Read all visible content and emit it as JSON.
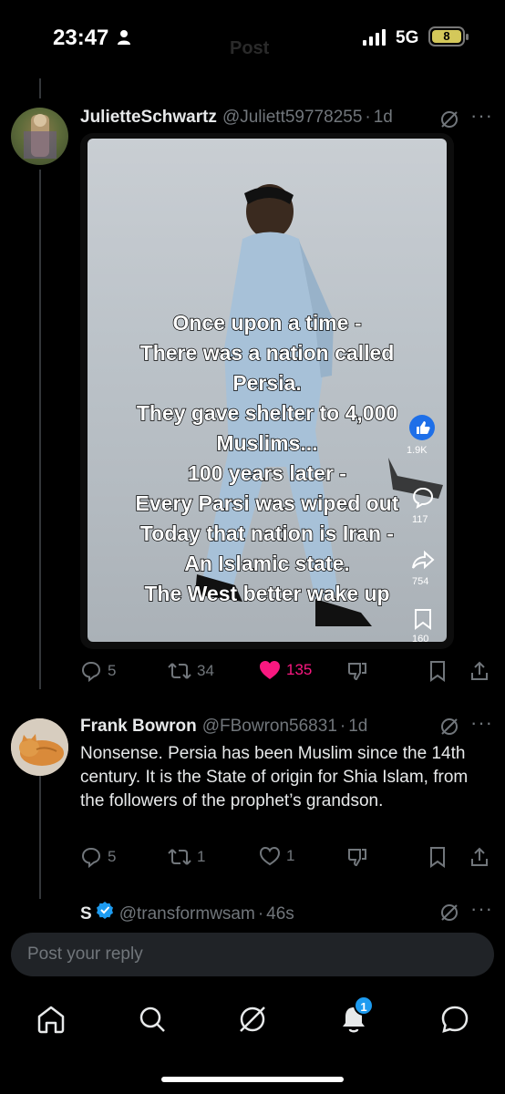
{
  "status_bar": {
    "time": "23:47",
    "network": "5G",
    "battery": "8",
    "ghost_title": "Post"
  },
  "tweets": [
    {
      "display_name": "JulietteSchwartz",
      "handle": "@Juliett59778255",
      "time_ago": "1d",
      "media_caption": [
        "Once upon a time -",
        "There was a nation called",
        "Persia.",
        "They gave shelter to 4,000",
        "Muslims...",
        "100 years later -",
        "Every Parsi was wiped out",
        "Today that nation is Iran -",
        "An Islamic state.",
        "The West better wake up"
      ],
      "media_side_counts": {
        "likes": "1.9K",
        "comments": "117",
        "shares": "754",
        "saves": "160"
      },
      "replies": "5",
      "reposts": "34",
      "likes": "135",
      "liked": true
    },
    {
      "display_name": "Frank Bowron",
      "handle": "@FBowron56831",
      "time_ago": "1d",
      "text": "Nonsense. Persia has been Muslim since the 14th century. It is the State of origin for Shia Islam, from the followers of the prophet’s grandson.",
      "replies": "5",
      "reposts": "1",
      "likes": "1",
      "liked": false
    },
    {
      "display_name": "S",
      "handle": "@transformwsam",
      "time_ago": "46s",
      "verified": true
    }
  ],
  "composer": {
    "placeholder": "Post your reply"
  },
  "nav": {
    "notifications_badge": "1"
  },
  "colors": {
    "accent": "#1d9bf0",
    "like": "#f91880",
    "muted": "#71767b",
    "background": "#000000"
  }
}
